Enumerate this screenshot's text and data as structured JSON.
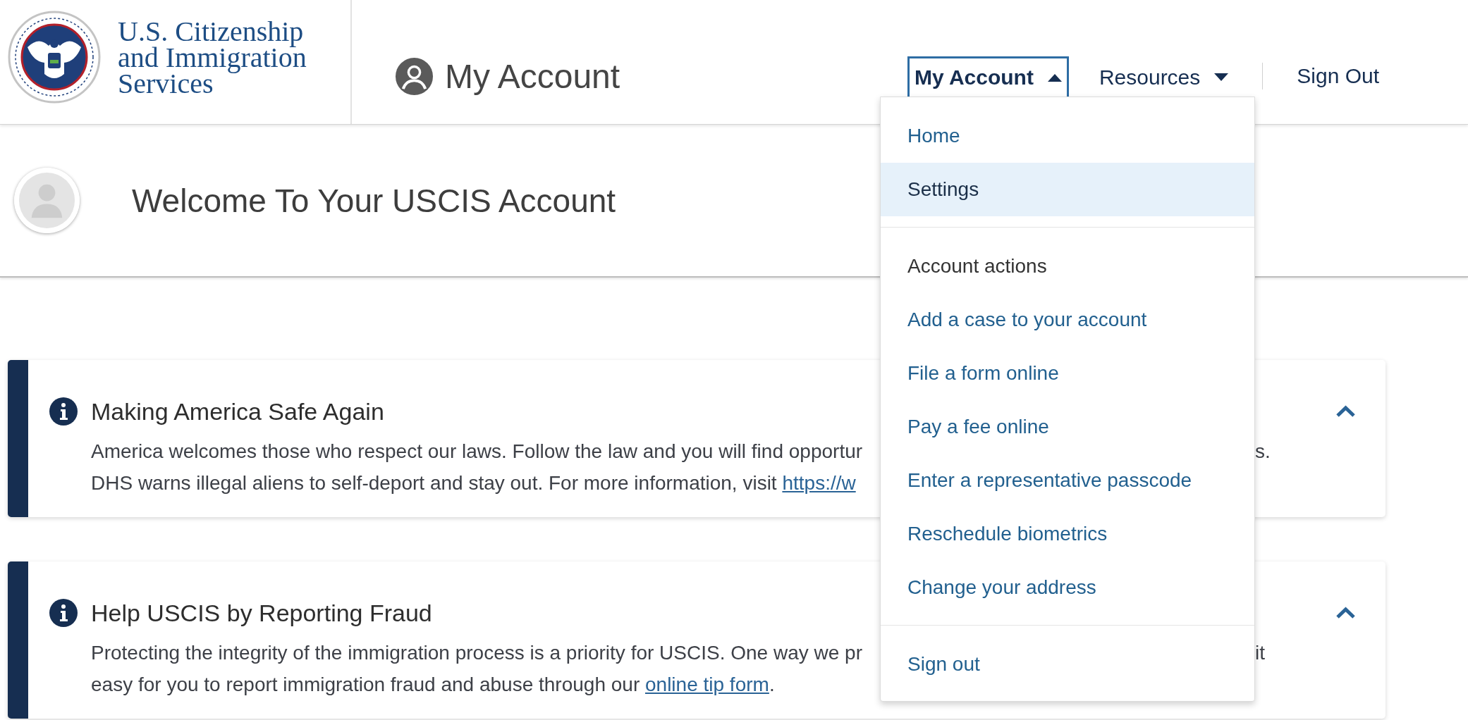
{
  "agency": {
    "lines": [
      "U.S. Citizenship",
      "and Immigration",
      "Services"
    ]
  },
  "app_title": "My Account",
  "nav": [
    {
      "label": "My Account",
      "kind": "menu",
      "expanded": true,
      "menu": {
        "sections": [
          {
            "items": [
              {
                "label": "Home",
                "selected": false
              },
              {
                "label": "Settings",
                "selected": true
              }
            ]
          },
          {
            "heading": "Account actions",
            "items": [
              {
                "label": "Add a case to your account",
                "selected": false
              },
              {
                "label": "File a form online",
                "selected": false
              },
              {
                "label": "Pay a fee online",
                "selected": false
              },
              {
                "label": "Enter a representative passcode",
                "selected": false
              },
              {
                "label": "Reschedule biometrics",
                "selected": false
              },
              {
                "label": "Change your address",
                "selected": false
              }
            ]
          },
          {
            "items": [
              {
                "label": "Sign out",
                "selected": false
              }
            ]
          }
        ]
      }
    },
    {
      "label": "Resources",
      "kind": "menu",
      "expanded": false
    },
    {
      "label": "Sign Out",
      "kind": "link"
    }
  ],
  "welcome": {
    "heading": "Welcome To Your USCIS Account"
  },
  "alerts": [
    {
      "title": "Making America Safe Again",
      "expanded": true,
      "lines": [
        {
          "segments": [
            {
              "kind": "text",
              "text": "America welcomes those who respect our laws. Follow the law and you will find opportur"
            }
          ],
          "right_of_menu": "s."
        },
        {
          "segments": [
            {
              "kind": "text",
              "text": "DHS warns illegal aliens to self-deport and stay out. For more information, visit "
            },
            {
              "kind": "link",
              "text": "https://w"
            }
          ]
        }
      ]
    },
    {
      "title": "Help USCIS by Reporting Fraud",
      "expanded": true,
      "lines": [
        {
          "segments": [
            {
              "kind": "text",
              "text": "Protecting the integrity of the immigration process is a priority for USCIS. One way we pr"
            }
          ],
          "right_of_menu": "it"
        },
        {
          "segments": [
            {
              "kind": "text",
              "text": "easy for you to report immigration fraud and abuse through our "
            },
            {
              "kind": "link",
              "text": "online tip form"
            },
            {
              "kind": "text",
              "text": "."
            }
          ]
        }
      ]
    }
  ]
}
